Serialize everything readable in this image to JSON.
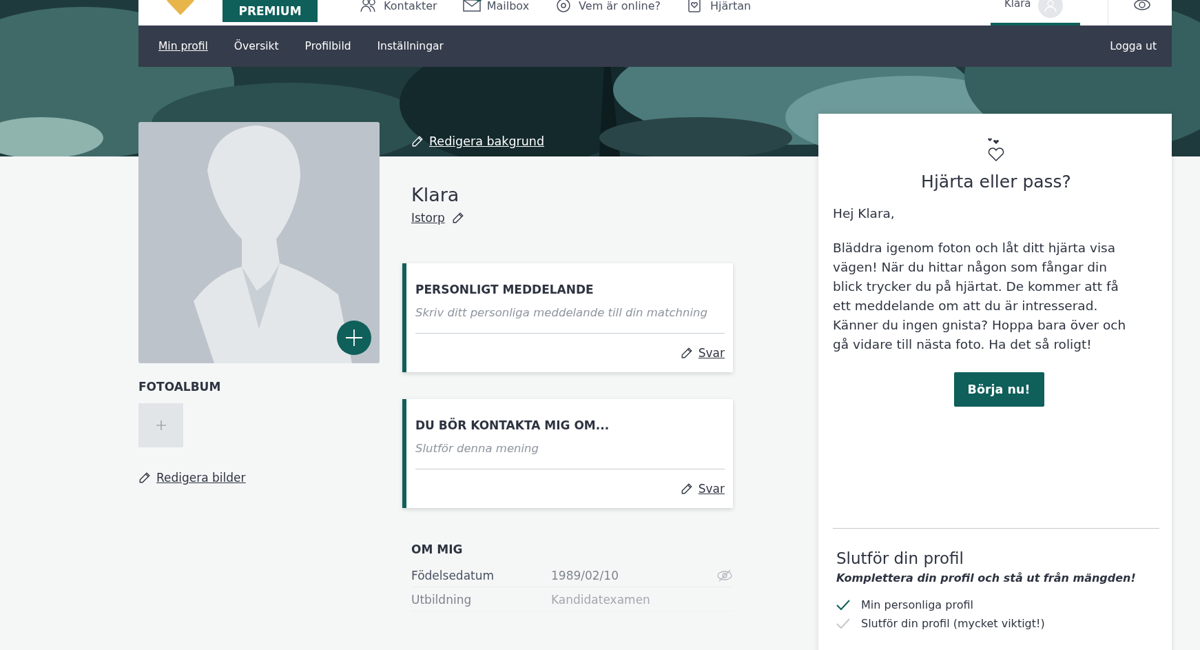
{
  "top_nav": {
    "premium": "PREMIUM",
    "items": [
      {
        "label": "Kontakter",
        "kind": "contacts",
        "badge": false
      },
      {
        "label": "Mailbox",
        "kind": "mail",
        "badge": true
      },
      {
        "label": "Vem är online?",
        "kind": "online",
        "badge": false
      },
      {
        "label": "Hjärtan",
        "kind": "hearts",
        "badge": false
      }
    ],
    "user": {
      "name": "Klara",
      "selected": true
    }
  },
  "sub_nav": {
    "items": [
      {
        "label": "Min profil",
        "selected": true
      },
      {
        "label": "Översikt",
        "selected": false
      },
      {
        "label": "Profilbild",
        "selected": false
      },
      {
        "label": "Inställningar",
        "selected": false
      }
    ],
    "logout": "Logga ut"
  },
  "edit_background": "Redigera bakgrund",
  "photo_album": {
    "title": "FOTOALBUM",
    "edit": "Redigera bilder"
  },
  "profile": {
    "name": "Klara",
    "location": "Istorp"
  },
  "cards": [
    {
      "title": "PERSONLIGT MEDDELANDE",
      "placeholder": "Skriv ditt personliga meddelande till din matchning",
      "action": "Svar"
    },
    {
      "title": "DU BÖR KONTAKTA MIG OM...",
      "placeholder": "Slutför denna mening",
      "action": "Svar"
    }
  ],
  "about": {
    "title": "OM MIG",
    "rows": [
      {
        "label": "Födelsedatum",
        "value": "1989/02/10",
        "hidden": true
      },
      {
        "label": "Utbildning",
        "value": "Kandidatexamen",
        "hidden": false
      }
    ]
  },
  "promo": {
    "title": "Hjärta eller pass?",
    "greeting": "Hej Klara,",
    "body": "Bläddra igenom foton och låt ditt hjärta visa vägen! När du hittar någon som fångar din blick trycker du på hjärtat. De kommer att få ett meddelande om att du är intresserad. Känner du ingen gnista? Hoppa bara över och gå vidare till nästa foto. Ha det så roligt!",
    "button": "Börja nu!"
  },
  "complete": {
    "title": "Slutför din profil",
    "subtitle": "Komplettera din profil och stå ut från mängden!",
    "items": [
      {
        "label": "Min personliga profil",
        "done": true
      },
      {
        "label": "Slutför din profil (mycket viktigt!)",
        "done": false
      }
    ]
  }
}
